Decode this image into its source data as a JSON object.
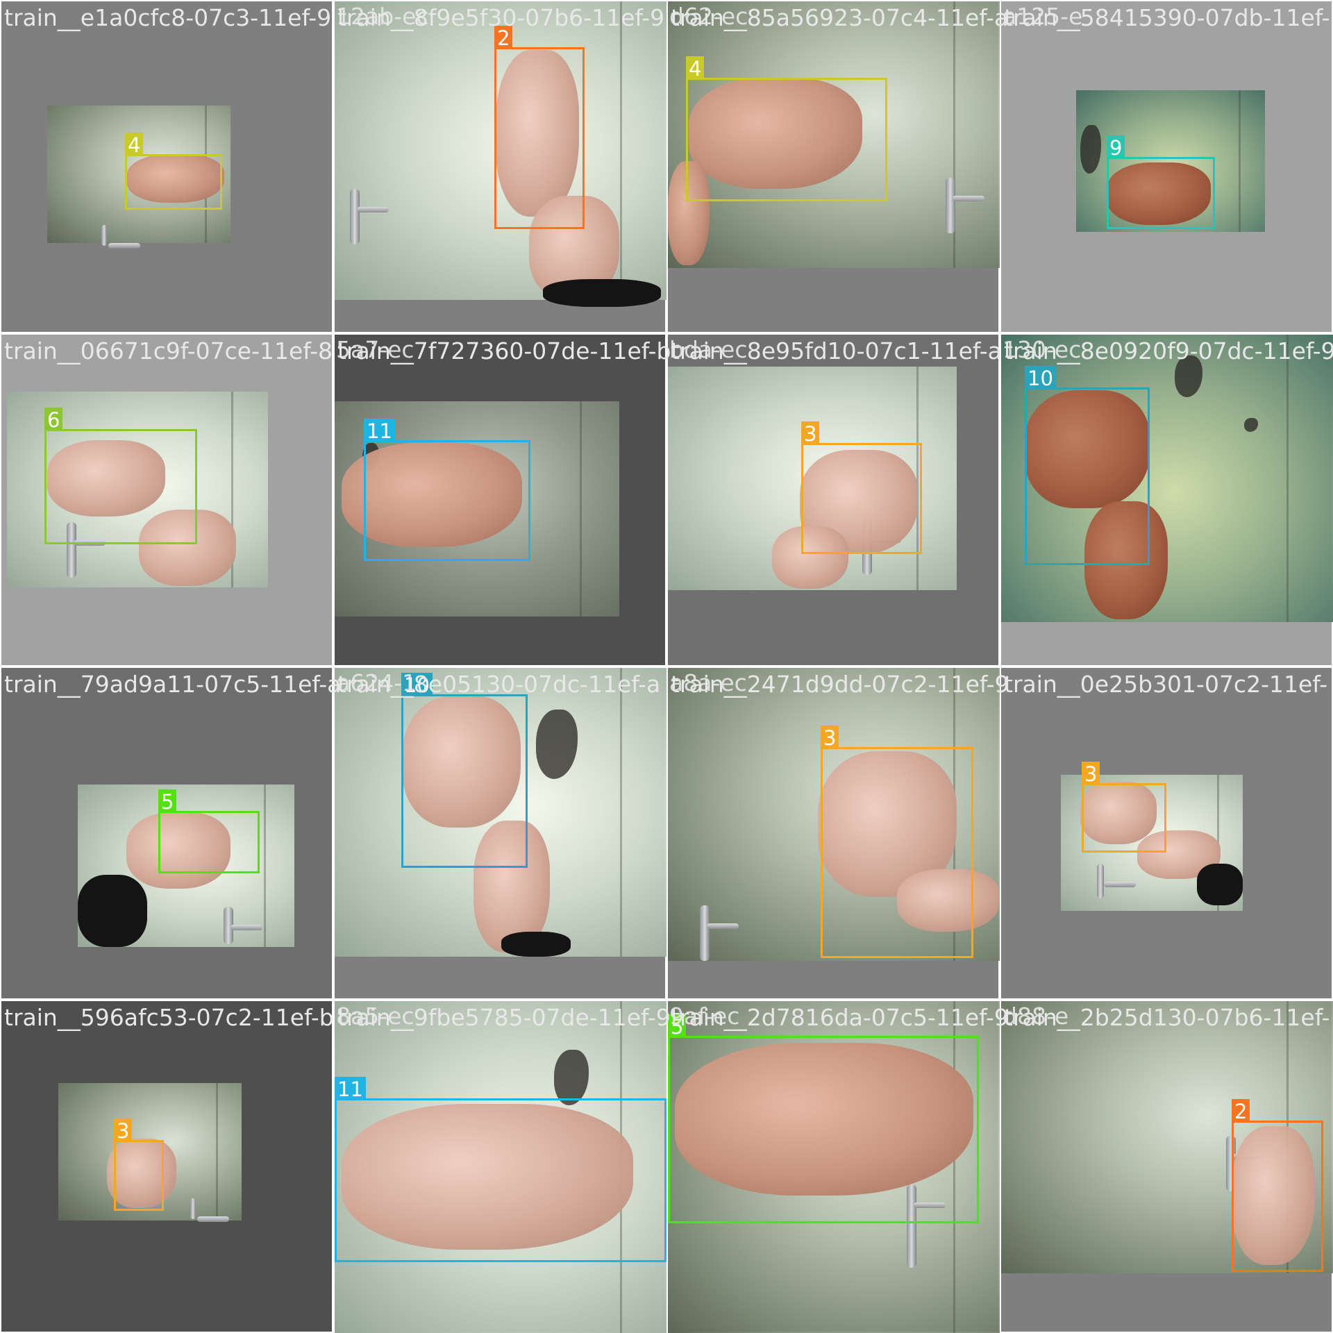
{
  "mosaic": {
    "tiles": [
      {
        "filename": "train__e1a0cfc8-07c3-11ef-9",
        "background": "#7f7f7f",
        "detections": [
          {
            "label": "4",
            "color": "#c9c92b"
          }
        ]
      },
      {
        "filename": "train__8f9e5f30-07b6-11ef-9",
        "background": "#7f7f7f",
        "detections": [
          {
            "label": "2",
            "color": "#f47421"
          }
        ]
      },
      {
        "filename": "train__85a56923-07c4-11ef-a",
        "background": "#7f7f7f",
        "detections": [
          {
            "label": "4",
            "color": "#c9c92b"
          }
        ]
      },
      {
        "filename": "train__58415390-07db-11ef-",
        "background": "#a2a2a2",
        "detections": [
          {
            "label": "9",
            "color": "#26c6b0"
          }
        ]
      },
      {
        "filename": "train__06671c9f-07ce-11ef-8",
        "background": "#a2a2a2",
        "detections": [
          {
            "label": "6",
            "color": "#8cc630"
          }
        ]
      },
      {
        "filename": "train__7f727360-07de-11ef-b",
        "background": "#4f4f4f",
        "detections": [
          {
            "label": "11",
            "color": "#1fb4e4"
          }
        ]
      },
      {
        "filename": "train__8e95fd10-07c1-11ef-a",
        "background": "#707070",
        "detections": [
          {
            "label": "3",
            "color": "#f5a623"
          }
        ]
      },
      {
        "filename": "train__8e0920f9-07dc-11ef-9",
        "background": "#a2a2a2",
        "detections": [
          {
            "label": "10",
            "color": "#2aa3bd"
          }
        ]
      },
      {
        "filename": "train__79ad9a11-07c5-11ef-a",
        "background": "#6e6e6e",
        "detections": [
          {
            "label": "5",
            "color": "#55e016"
          }
        ]
      },
      {
        "filename": "train__8e05130-07dc-11ef-a",
        "background": "#7f7f7f",
        "detections": [
          {
            "label": "10",
            "color": "#2aa3bd"
          }
        ]
      },
      {
        "filename": "train__2471d9dd-07c2-11ef-9",
        "background": "#7f7f7f",
        "detections": [
          {
            "label": "3",
            "color": "#f5a623"
          }
        ]
      },
      {
        "filename": "train__0e25b301-07c2-11ef-",
        "background": "#7f7f7f",
        "detections": [
          {
            "label": "3",
            "color": "#f5a623"
          }
        ]
      },
      {
        "filename": "train__596afc53-07c2-11ef-b",
        "background": "#4f4f4f",
        "detections": [
          {
            "label": "3",
            "color": "#f5a623"
          }
        ]
      },
      {
        "filename": "train__9fbe5785-07de-11ef-9",
        "background": "#7f7f7f",
        "detections": [
          {
            "label": "11",
            "color": "#1fb4e4"
          }
        ]
      },
      {
        "filename": "train__2d7816da-07c5-11ef-9",
        "background": "#7f7f7f",
        "detections": [
          {
            "label": "5",
            "color": "#55e016"
          }
        ]
      },
      {
        "filename": "train__2b25d130-07b6-11ef-",
        "background": "#7f7f7f",
        "detections": [
          {
            "label": "2",
            "color": "#f47421"
          }
        ]
      }
    ],
    "spill_text": [
      "12ab-ec",
      "d62-ec",
      "a125-e",
      "5a7-ec",
      "bda-ec",
      "130-ec",
      "a624-1",
      "a8a-ec",
      "8a5-ec",
      "9af-ec",
      "d88-e"
    ]
  }
}
